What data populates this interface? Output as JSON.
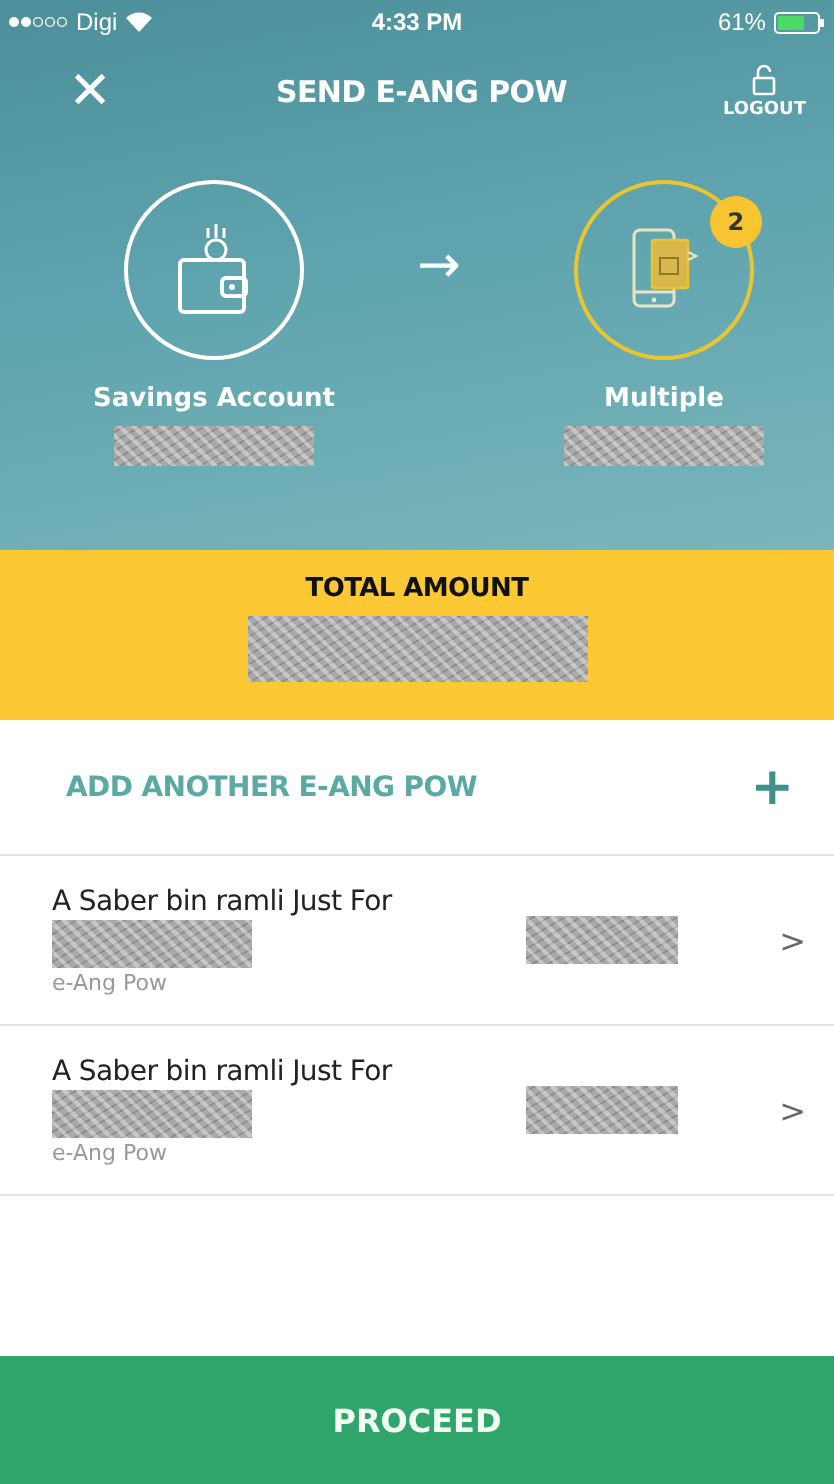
{
  "status_bar": {
    "carrier": "Digi",
    "time": "4:33 PM",
    "battery": "61%"
  },
  "header": {
    "close": "✕",
    "title": "SEND E-ANG POW",
    "logout": "LOGOUT"
  },
  "transfer": {
    "from": {
      "label": "Savings Account",
      "active": false
    },
    "arrow": "→",
    "to": {
      "label": "Multiple",
      "active": true,
      "badge": "2"
    }
  },
  "total": {
    "label": "TOTAL AMOUNT"
  },
  "add_row": {
    "label": "ADD ANOTHER E-ANG POW",
    "icon": "+"
  },
  "items": [
    {
      "title": "A Saber bin ramli Just For",
      "subtitle": "e-Ang Pow",
      "chevron": ">"
    },
    {
      "title": "A Saber bin ramli Just For",
      "subtitle": "e-Ang Pow",
      "chevron": ">"
    }
  ],
  "proceed": "PROCEED"
}
